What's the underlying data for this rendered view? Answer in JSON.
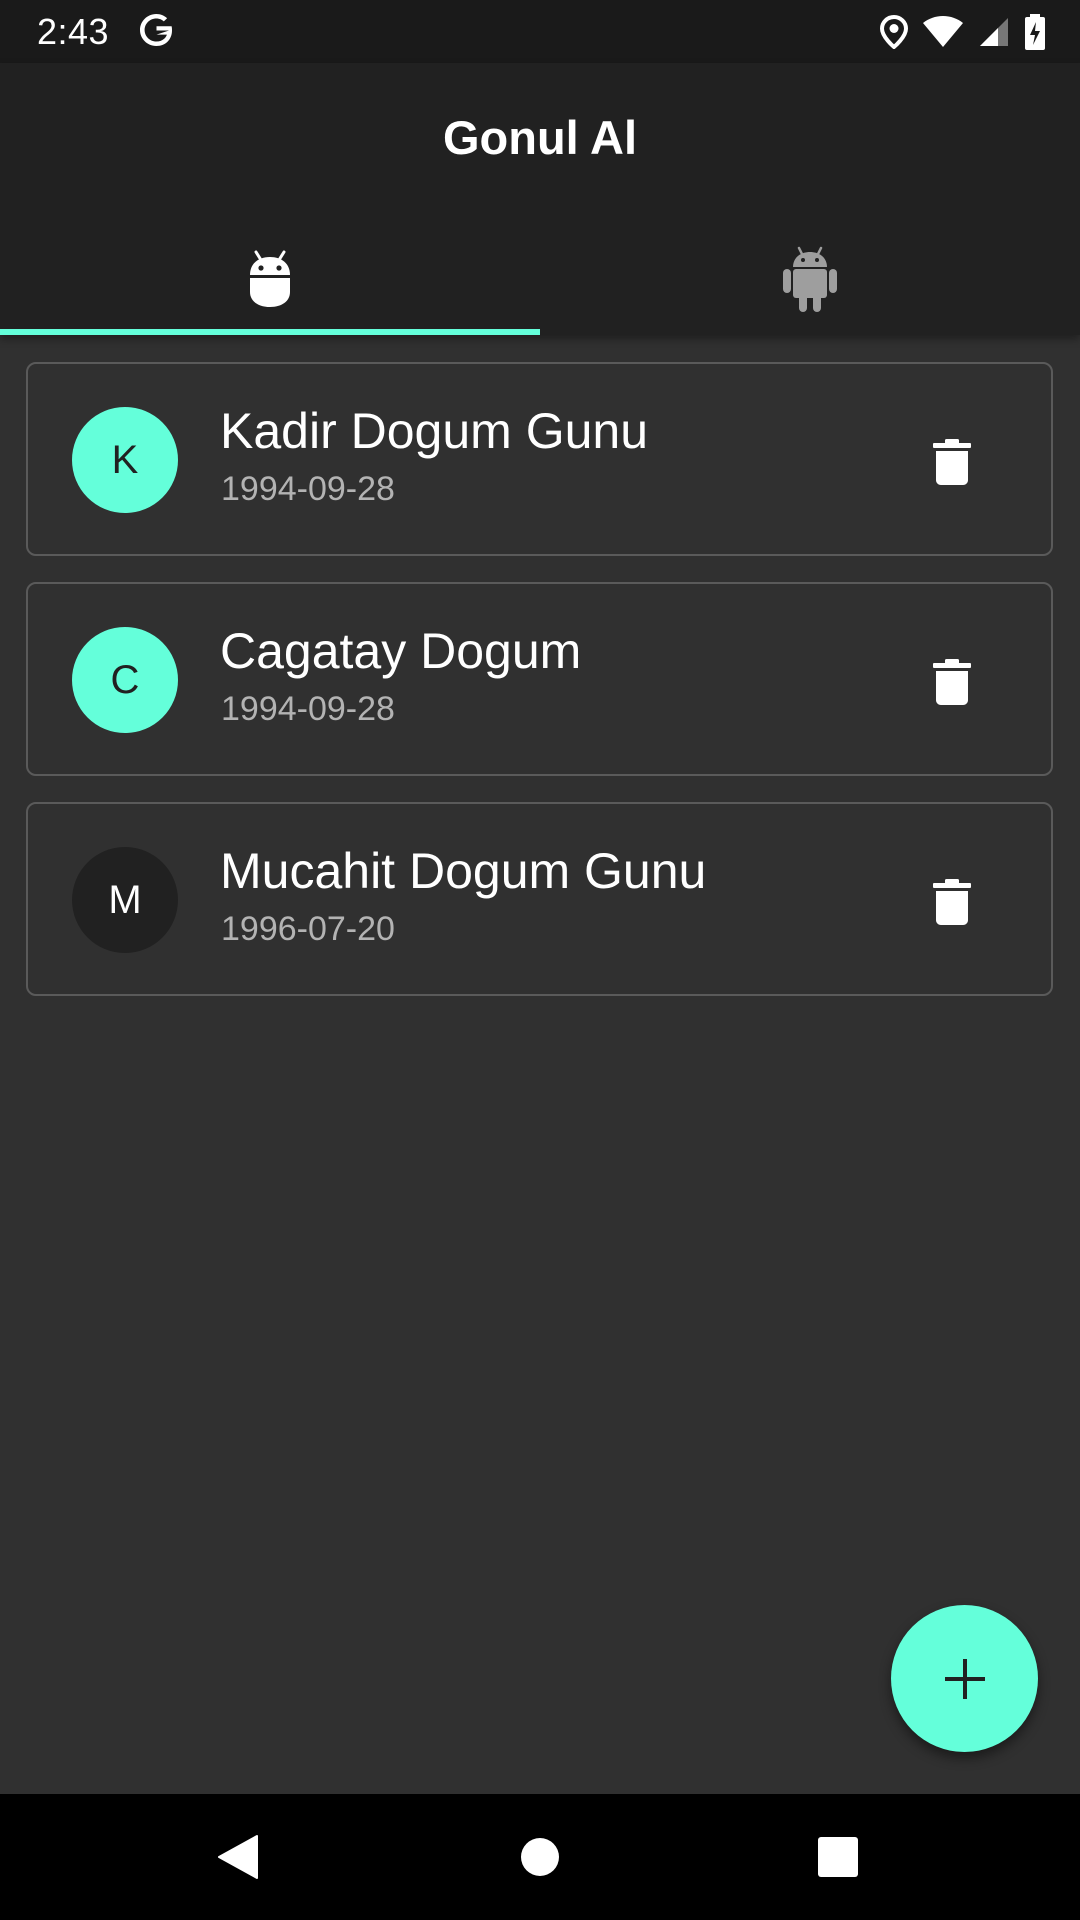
{
  "status_bar": {
    "time": "2:43",
    "icons": [
      "google-icon",
      "location-icon",
      "wifi-icon",
      "signal-icon",
      "battery-charging-icon"
    ]
  },
  "app": {
    "title": "Gonul Al"
  },
  "tabs": [
    {
      "icon": "android-head-icon",
      "selected": true
    },
    {
      "icon": "android-robot-icon",
      "selected": false
    }
  ],
  "items": [
    {
      "initial": "K",
      "title": "Kadir Dogum Gunu",
      "date": "1994-09-28",
      "avatar_color": "#64ffda"
    },
    {
      "initial": "C",
      "title": "Cagatay Dogum",
      "date": "1994-09-28",
      "avatar_color": "#64ffda"
    },
    {
      "initial": "M",
      "title": "Mucahit Dogum Gunu",
      "date": "1996-07-20",
      "avatar_color": "#212121"
    }
  ],
  "fab": {
    "icon": "plus-icon"
  },
  "nav": [
    "back-icon",
    "home-icon",
    "recents-icon"
  ],
  "colors": {
    "accent": "#64ffda",
    "background": "#303030",
    "app_bar": "#212121"
  }
}
